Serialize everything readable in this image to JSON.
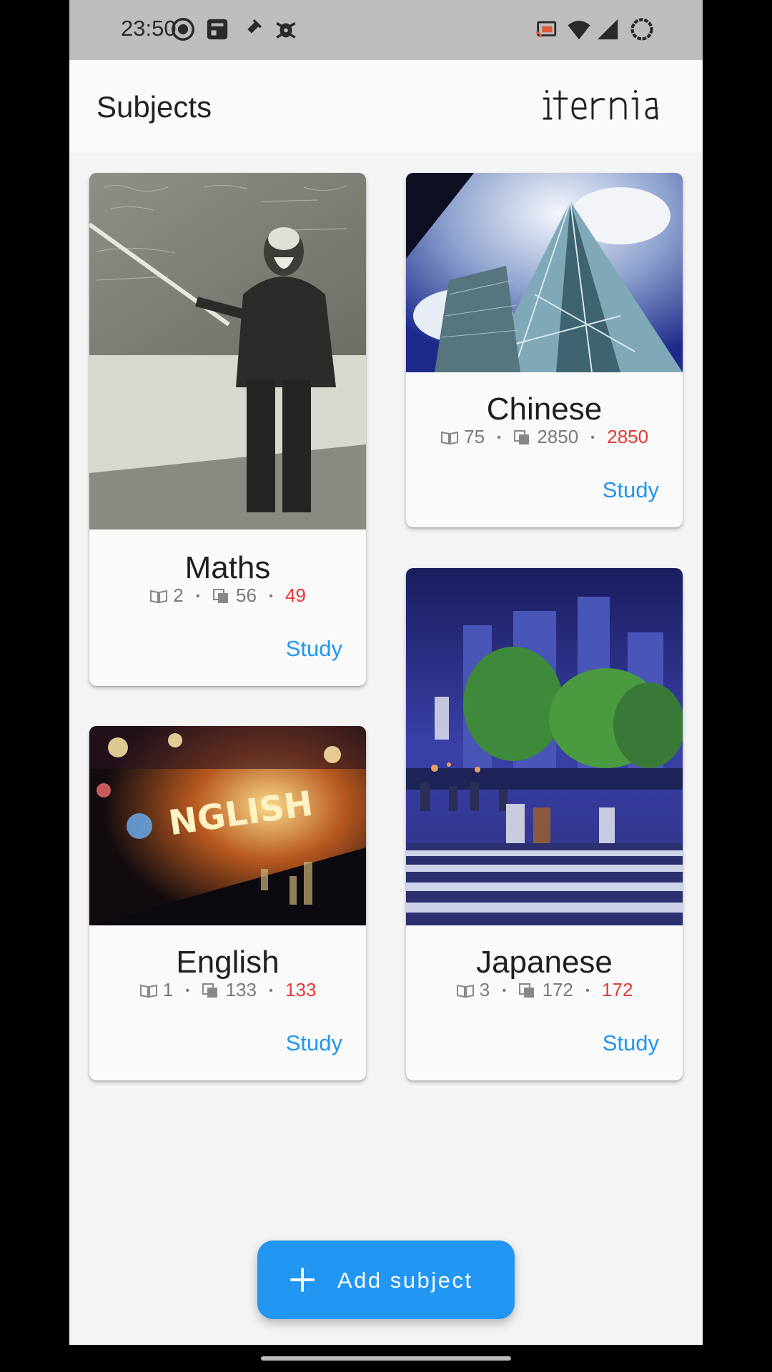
{
  "status_bar": {
    "time": "23:50",
    "icons": [
      "record-icon",
      "app-icon",
      "tool-icon",
      "bug-icon",
      "cast-icon",
      "wifi-icon",
      "signal-icon",
      "battery-icon"
    ]
  },
  "app_bar": {
    "title": "Subjects",
    "logo_text": "iternia"
  },
  "subjects": [
    {
      "name": "Maths",
      "decks": "2",
      "cards": "56",
      "due": "49",
      "action": "Study"
    },
    {
      "name": "Chinese",
      "decks": "75",
      "cards": "2850",
      "due": "2850",
      "action": "Study"
    },
    {
      "name": "English",
      "decks": "1",
      "cards": "133",
      "due": "133",
      "action": "Study"
    },
    {
      "name": "Japanese",
      "decks": "3",
      "cards": "172",
      "due": "172",
      "action": "Study"
    }
  ],
  "fab": {
    "label": "Add subject",
    "icon": "plus-icon"
  },
  "colors": {
    "accent": "#2196f3",
    "due": "#e53935",
    "background": "#f4f4f4"
  }
}
